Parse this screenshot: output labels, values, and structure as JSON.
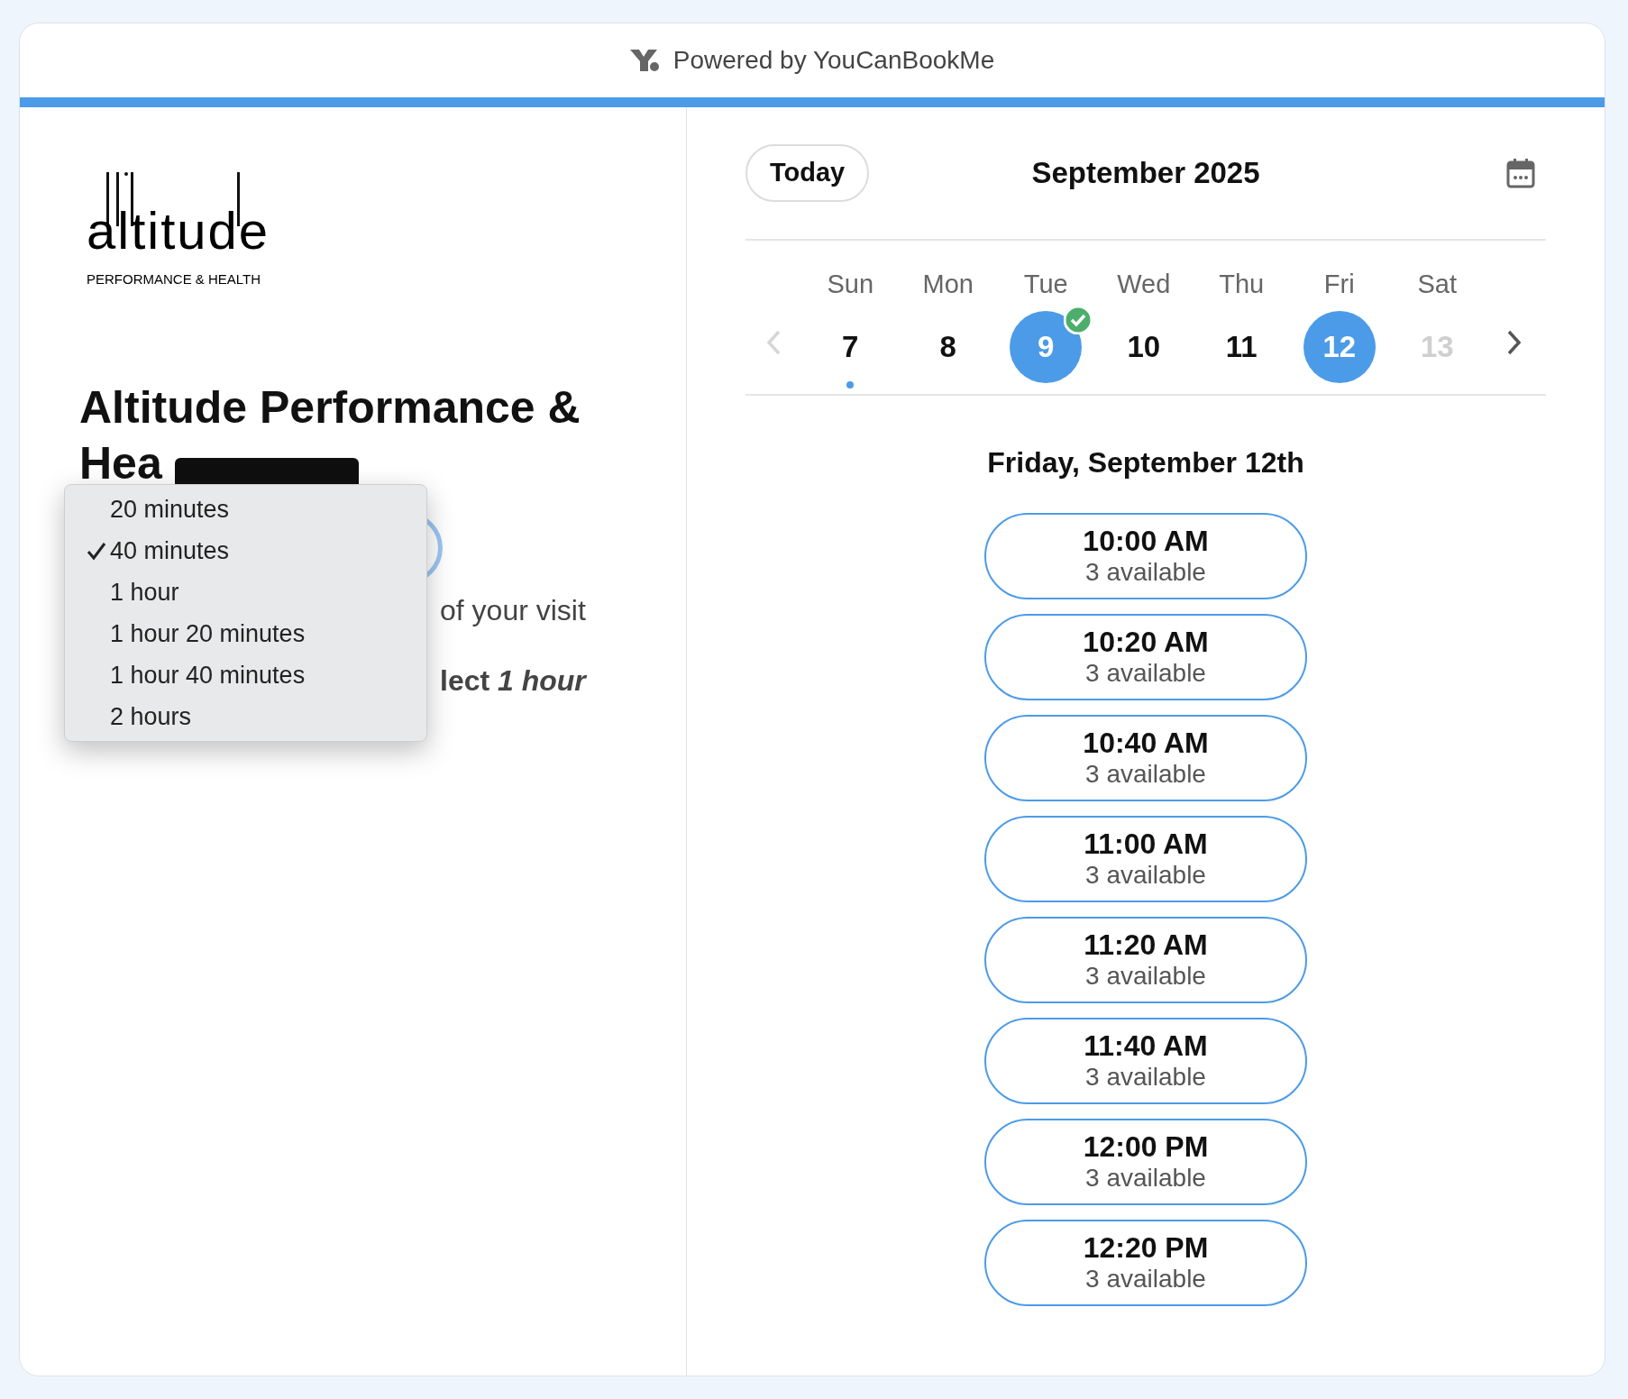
{
  "header": {
    "text": "Powered by YouCanBookMe"
  },
  "progress": {
    "level": 1
  },
  "logo": {
    "wordmark": "altitude",
    "tagline": "PERFORMANCE & HEALTH"
  },
  "title_lines": [
    "Altitude Performance &",
    "Hea"
  ],
  "description_fragments": [
    {
      "text": "of your visit",
      "bold": false
    },
    {
      "text": "lect *1 hour*",
      "bold": true
    }
  ],
  "duration_menu": [
    {
      "label": "20 minutes",
      "selected": false
    },
    {
      "label": "40 minutes",
      "selected": true
    },
    {
      "label": "1 hour",
      "selected": false
    },
    {
      "label": "1 hour 20 minutes",
      "selected": false
    },
    {
      "label": "1 hour 40 minutes",
      "selected": false
    },
    {
      "label": "2 hours",
      "selected": false
    }
  ],
  "calendar": {
    "today_button": "Today",
    "month": "September 2025",
    "prev_disabled": true,
    "next_disabled": false,
    "days": [
      {
        "weekday": "Sun",
        "date": "7",
        "selected": false,
        "checked": false,
        "dot": true,
        "disabled": false
      },
      {
        "weekday": "Mon",
        "date": "8",
        "selected": false,
        "checked": false,
        "dot": false,
        "disabled": false
      },
      {
        "weekday": "Tue",
        "date": "9",
        "selected": false,
        "checked": true,
        "dot": false,
        "disabled": false
      },
      {
        "weekday": "Wed",
        "date": "10",
        "selected": false,
        "checked": false,
        "dot": false,
        "disabled": false
      },
      {
        "weekday": "Thu",
        "date": "11",
        "selected": false,
        "checked": false,
        "dot": false,
        "disabled": false
      },
      {
        "weekday": "Fri",
        "date": "12",
        "selected": true,
        "checked": false,
        "dot": false,
        "disabled": false
      },
      {
        "weekday": "Sat",
        "date": "13",
        "selected": false,
        "checked": false,
        "dot": false,
        "disabled": true
      }
    ]
  },
  "day_heading": "Friday, September 12th",
  "slots": [
    {
      "time": "10:00 AM",
      "availability": "3 available"
    },
    {
      "time": "10:20 AM",
      "availability": "3 available"
    },
    {
      "time": "10:40 AM",
      "availability": "3 available"
    },
    {
      "time": "11:00 AM",
      "availability": "3 available"
    },
    {
      "time": "11:20 AM",
      "availability": "3 available"
    },
    {
      "time": "11:40 AM",
      "availability": "3 available"
    },
    {
      "time": "12:00 PM",
      "availability": "3 available"
    },
    {
      "time": "12:20 PM",
      "availability": "3 available"
    }
  ]
}
